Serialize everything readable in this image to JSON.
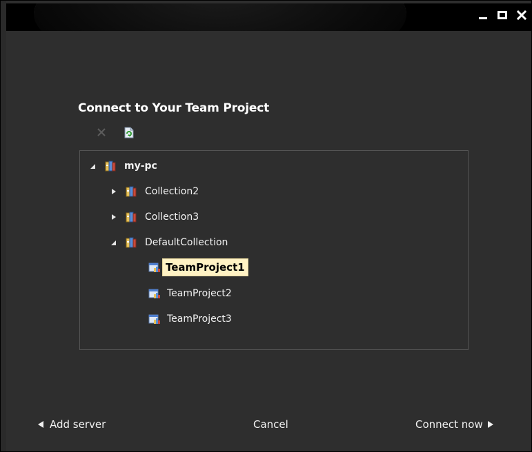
{
  "window": {
    "controls": [
      "minimize-icon",
      "maximize-icon",
      "close-icon"
    ]
  },
  "dialog": {
    "heading": "Connect to Your Team Project",
    "toolbar": {
      "remove_icon": "close-x-icon",
      "refresh_icon": "refresh-icon"
    }
  },
  "tree": {
    "server": {
      "label": "my-pc",
      "expanded": true
    },
    "collections": [
      {
        "label": "Collection2",
        "expanded": false
      },
      {
        "label": "Collection3",
        "expanded": false
      },
      {
        "label": "DefaultCollection",
        "expanded": true
      }
    ],
    "projects": [
      {
        "label": "TeamProject1",
        "selected": true
      },
      {
        "label": "TeamProject2",
        "selected": false
      },
      {
        "label": "TeamProject3",
        "selected": false
      }
    ]
  },
  "footer": {
    "add_server": "Add server",
    "cancel": "Cancel",
    "connect_now": "Connect now"
  },
  "colors": {
    "background": "#2e2e2e",
    "titlebar": "#000000",
    "selection": "#fff2c4",
    "text": "#f0f0f0"
  }
}
